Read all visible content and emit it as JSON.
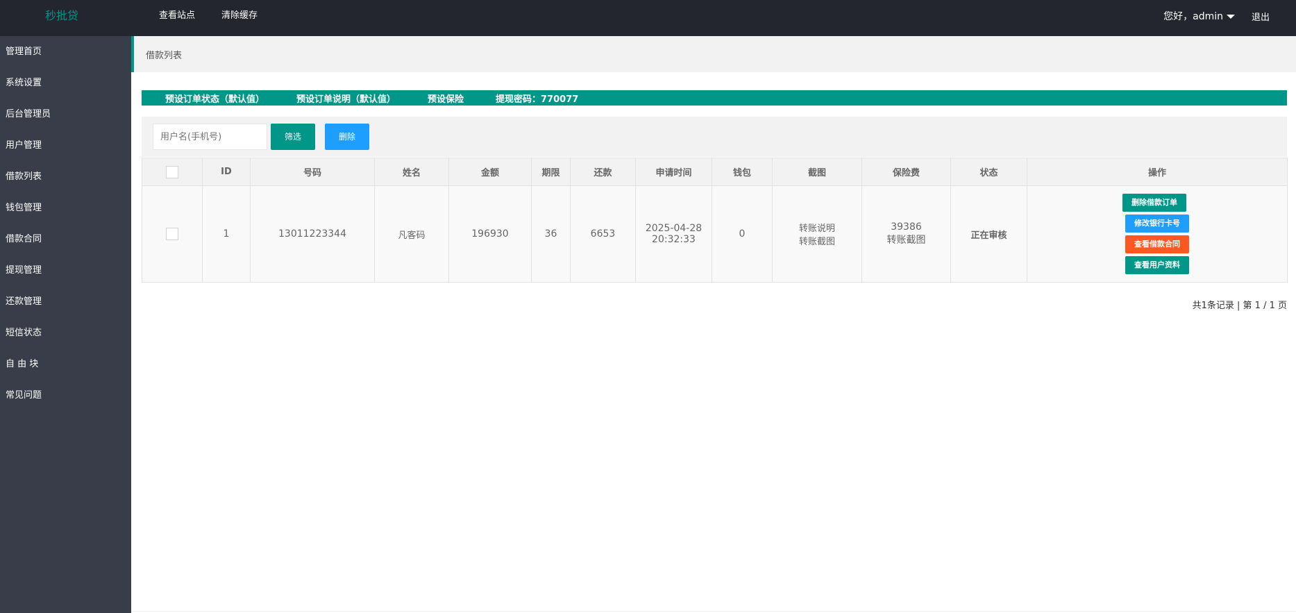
{
  "brand": "秒批贷",
  "topnav": [
    "查看站点",
    "清除缓存"
  ],
  "user": {
    "greeting": "您好，admin",
    "logout": "退出"
  },
  "sidebar": [
    "管理首页",
    "系统设置",
    "后台管理员",
    "用户管理",
    "借款列表",
    "钱包管理",
    "借款合同",
    "提现管理",
    "还款管理",
    "短信状态",
    "自 由 块",
    "常见问题"
  ],
  "page_title": "借款列表",
  "banner": [
    "预设订单状态（默认值）",
    "预设订单说明（默认值）",
    "预设保险",
    "提现密码：770077"
  ],
  "filter": {
    "placeholder": "用户名(手机号)",
    "filter_label": "筛选",
    "delete_label": "删除"
  },
  "table": {
    "headers": [
      "ID",
      "号码",
      "姓名",
      "金额",
      "期限",
      "还款",
      "申请时间",
      "钱包",
      "截图",
      "保险费",
      "状态",
      "操作"
    ],
    "row": {
      "id": "1",
      "phone": "13011223344",
      "name": "凡客码",
      "amount": "196930",
      "term": "36",
      "repay": "6653",
      "date": "2025-04-28",
      "time": "20:32:33",
      "wallet": "0",
      "screenshot_1": "转账说明",
      "screenshot_2": "转账截图",
      "insurance_value": "39386",
      "insurance_link": "转账截图",
      "status": "正在审核",
      "actions": [
        "删除借款订单",
        "修改银行卡号",
        "查看借款合同",
        "查看用户资料"
      ]
    }
  },
  "pagination": "共1条记录 | 第 1 / 1 页",
  "colors": {
    "topbar": "#23262e",
    "sidebar": "#393d49",
    "accent": "#009688",
    "blue": "#1e9fff",
    "orange": "#ff5722",
    "status_green": "#5fb878"
  }
}
